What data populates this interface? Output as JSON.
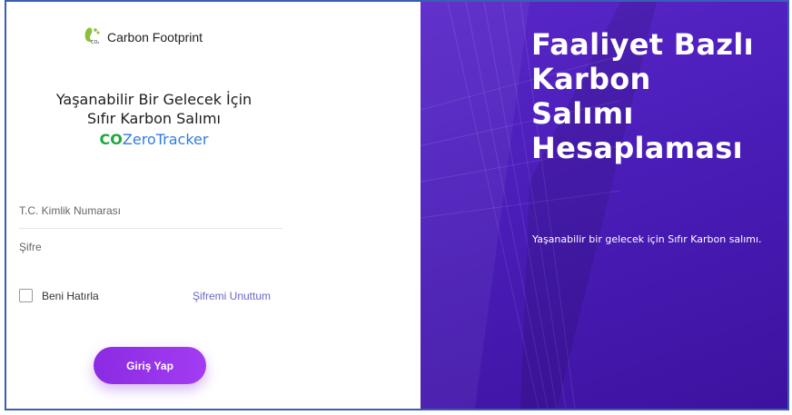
{
  "logo": {
    "brand": "Carbon Footprint",
    "icon": "footprint-co2-icon",
    "icon_mark": "CO₂"
  },
  "heading": {
    "line1": "Yaşanabilir Bir Gelecek İçin",
    "line2": "Sıfır Karbon Salımı"
  },
  "tracker": {
    "co": "CO",
    "rest": "ZeroTracker"
  },
  "form": {
    "id_label": "T.C. Kimlik Numarası",
    "password_label": "Şifre",
    "remember_label": "Beni Hatırla",
    "remember_checked": false,
    "forgot_label": "Şifremi Unuttum",
    "submit_label": "Giriş Yap"
  },
  "hero": {
    "title_lines": [
      "Faaliyet Bazlı",
      "Karbon",
      "Salımı",
      "Hesaplaması"
    ],
    "subtitle": "Yaşanabilir bir gelecek için Sıfır Karbon salımı."
  },
  "colors": {
    "accent": "#8b2be2",
    "hero_bg": "#4a1db8",
    "link": "#6b66c9",
    "co_green": "#1ea83a",
    "tracker_blue": "#2f7de1",
    "frame": "#3b5db3"
  }
}
